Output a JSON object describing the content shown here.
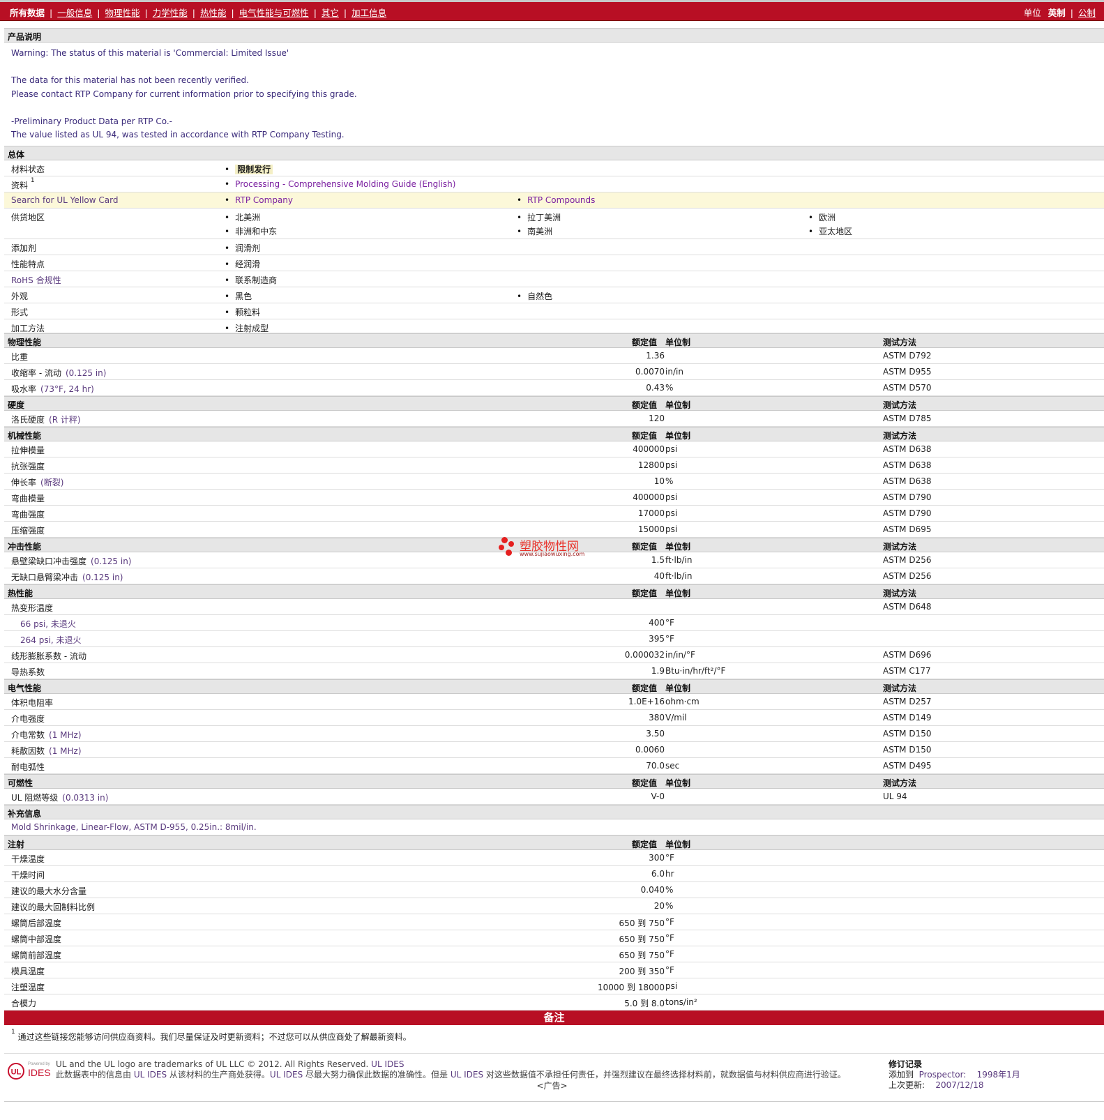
{
  "nav": {
    "items": [
      "所有数据",
      "一般信息",
      "物理性能",
      "力学性能",
      "热性能",
      "电气性能与可燃性",
      "其它",
      "加工信息"
    ],
    "unit_label": "单位",
    "unit_imperial": "英制",
    "unit_metric": "公制"
  },
  "description": {
    "title": "产品说明",
    "lines": [
      "Warning: The status of this material is 'Commercial: Limited Issue'",
      "",
      "The data for this material has not been recently verified.",
      "Please contact RTP Company for current information prior to specifying this grade.",
      "",
      "-Preliminary Product Data per RTP Co.-",
      "The value listed as UL 94, was tested in accordance with RTP Company Testing."
    ]
  },
  "general": {
    "title": "总体",
    "status_label": "材料状态",
    "status_value": "限制发行",
    "docs_label": "资料",
    "docs_sup": "1",
    "docs_link": "Processing - Comprehensive Molding Guide (English)",
    "ulcard_label": "Search for UL Yellow Card",
    "ulcard_links": [
      "RTP Company",
      "RTP Compounds"
    ],
    "regions_label": "供货地区",
    "regions": [
      "北美洲",
      "拉丁美洲",
      "欧洲",
      "非洲和中东",
      "南美洲",
      "亚太地区"
    ],
    "additive_label": "添加剂",
    "additive": "润滑剂",
    "features_label": "性能特点",
    "features": "经润滑",
    "rohs_label": "RoHS 合规性",
    "rohs": "联系制造商",
    "appearance_label": "外观",
    "appearance": [
      "黑色",
      "自然色"
    ],
    "form_label": "形式",
    "form": "颗粒料",
    "method_label": "加工方法",
    "method": "注射成型"
  },
  "headers": {
    "nominal": "额定值",
    "unit": "单位制",
    "test": "测试方法"
  },
  "physical": {
    "title": "物理性能",
    "rows": [
      {
        "label": "比重",
        "cond": "",
        "value": "1.36",
        "unit": "",
        "test": "ASTM D792"
      },
      {
        "label": "收缩率 - 流动",
        "cond": "(0.125 in)",
        "value": "0.0070",
        "unit": "in/in",
        "test": "ASTM D955"
      },
      {
        "label": "吸水率",
        "cond": "(73°F, 24 hr)",
        "value": "0.43",
        "unit": "%",
        "test": "ASTM D570"
      }
    ]
  },
  "hardness": {
    "title": "硬度",
    "rows": [
      {
        "label": "洛氏硬度",
        "cond": "(R 计秤)",
        "value": "120",
        "unit": "",
        "test": "ASTM D785"
      }
    ]
  },
  "mechanical": {
    "title": "机械性能",
    "rows": [
      {
        "label": "拉伸模量",
        "cond": "",
        "value": "400000",
        "unit": "psi",
        "test": "ASTM D638"
      },
      {
        "label": "抗张强度",
        "cond": "",
        "value": "12800",
        "unit": "psi",
        "test": "ASTM D638"
      },
      {
        "label": "伸长率",
        "cond": "(断裂)",
        "value": "10",
        "unit": "%",
        "test": "ASTM D638"
      },
      {
        "label": "弯曲模量",
        "cond": "",
        "value": "400000",
        "unit": "psi",
        "test": "ASTM D790"
      },
      {
        "label": "弯曲强度",
        "cond": "",
        "value": "17000",
        "unit": "psi",
        "test": "ASTM D790"
      },
      {
        "label": "压缩强度",
        "cond": "",
        "value": "15000",
        "unit": "psi",
        "test": "ASTM D695"
      }
    ]
  },
  "impact": {
    "title": "冲击性能",
    "rows": [
      {
        "label": "悬壁梁缺口冲击强度",
        "cond": "(0.125 in)",
        "value": "1.5",
        "unit": "ft·lb/in",
        "test": "ASTM D256"
      },
      {
        "label": "无缺口悬臂梁冲击",
        "cond": "(0.125 in)",
        "value": "40",
        "unit": "ft·lb/in",
        "test": "ASTM D256"
      }
    ]
  },
  "thermal": {
    "title": "热性能",
    "hdt_label": "热变形温度",
    "hdt_test": "ASTM D648",
    "hdt_sub": [
      {
        "label": "66 psi, 未退火",
        "value": "400",
        "unit": "°F"
      },
      {
        "label": "264 psi, 未退火",
        "value": "395",
        "unit": "°F"
      }
    ],
    "rows": [
      {
        "label": "线形膨胀系数 - 流动",
        "cond": "",
        "value": "0.000032",
        "unit": "in/in/°F",
        "test": "ASTM D696"
      },
      {
        "label": "导热系数",
        "cond": "",
        "value": "1.9",
        "unit": "Btu·in/hr/ft²/°F",
        "test": "ASTM C177"
      }
    ]
  },
  "electrical": {
    "title": "电气性能",
    "rows": [
      {
        "label": "体积电阻率",
        "cond": "",
        "value": "1.0E+16",
        "unit": "ohm·cm",
        "test": "ASTM D257"
      },
      {
        "label": "介电强度",
        "cond": "",
        "value": "380",
        "unit": "V/mil",
        "test": "ASTM D149"
      },
      {
        "label": "介电常数",
        "cond": "(1 MHz)",
        "value": "3.50",
        "unit": "",
        "test": "ASTM D150"
      },
      {
        "label": "耗散因数",
        "cond": "(1 MHz)",
        "value": "0.0060",
        "unit": "",
        "test": "ASTM D150"
      },
      {
        "label": "耐电弧性",
        "cond": "",
        "value": "70.0",
        "unit": "sec",
        "test": "ASTM D495"
      }
    ]
  },
  "flammability": {
    "title": "可燃性",
    "rows": [
      {
        "label": "UL 阻燃等级",
        "cond": "(0.0313 in)",
        "value": "V-0",
        "unit": "",
        "test": "UL 94"
      }
    ]
  },
  "supplement": {
    "title": "补充信息",
    "text": "Mold Shrinkage, Linear-Flow, ASTM D-955, 0.25in.: 8mil/in."
  },
  "injection": {
    "title": "注射",
    "rows": [
      {
        "label": "干燥温度",
        "value": "300",
        "unit": "°F"
      },
      {
        "label": "干燥时间",
        "value": "6.0",
        "unit": "hr"
      },
      {
        "label": "建议的最大水分含量",
        "value": "0.040",
        "unit": "%"
      },
      {
        "label": "建议的最大回制料比例",
        "value": "20",
        "unit": "%"
      },
      {
        "label": "螺筒后部温度",
        "value": "650 到  750",
        "unit": "°F"
      },
      {
        "label": "螺筒中部温度",
        "value": "650 到  750",
        "unit": "°F"
      },
      {
        "label": "螺筒前部温度",
        "value": "650 到  750",
        "unit": "°F"
      },
      {
        "label": "模具温度",
        "value": "200 到  350",
        "unit": "°F"
      },
      {
        "label": "注塑温度",
        "value": "10000 到  18000",
        "unit": "psi"
      },
      {
        "label": "合模力",
        "value": "5.0 到  8.0",
        "unit": "tons/in²"
      }
    ]
  },
  "notes": {
    "title": "备注",
    "sup": "1",
    "text": "通过这些链接您能够访问供应商资料。我们尽量保证及时更新资料；不过您可以从供应商处了解最新资料。"
  },
  "footer": {
    "logo_small": "Powered by",
    "logo_ul": "UL",
    "logo_ides": "IDES",
    "line1_pre": "UL and the UL logo are trademarks of UL LLC © 2012. All Rights Reserved. ",
    "line1_link": "UL IDES",
    "line2_a": "此数据表中的信息由 ",
    "line2_b": "UL IDES",
    "line2_c": " 从该材料的生产商处获得。",
    "line2_d": "UL IDES",
    "line2_e": " 尽最大努力确保此数据的准确性。但是 ",
    "line2_f": "UL IDES",
    "line2_g": " 对这些数据值不承担任何责任，并强烈建议在最终选择材料前，就数据值与材料供应商进行验证。",
    "rev_title": "修订记录",
    "rev_added_label": "添加到",
    "rev_added_where": "Prospector:",
    "rev_added_date": "1998年1月",
    "rev_updated_label": "上次更新:",
    "rev_updated_date": "2007/12/18"
  },
  "ad_label": "<广告>",
  "watermark": {
    "cn": "塑胶物性网",
    "en": "www.sujiaowuxing.com"
  },
  "colors": {
    "brand_red": "#b80f24",
    "link_purple": "#7a1fa0",
    "section_gray": "#e6e6e6",
    "highlight_row": "#fcf8d9"
  }
}
